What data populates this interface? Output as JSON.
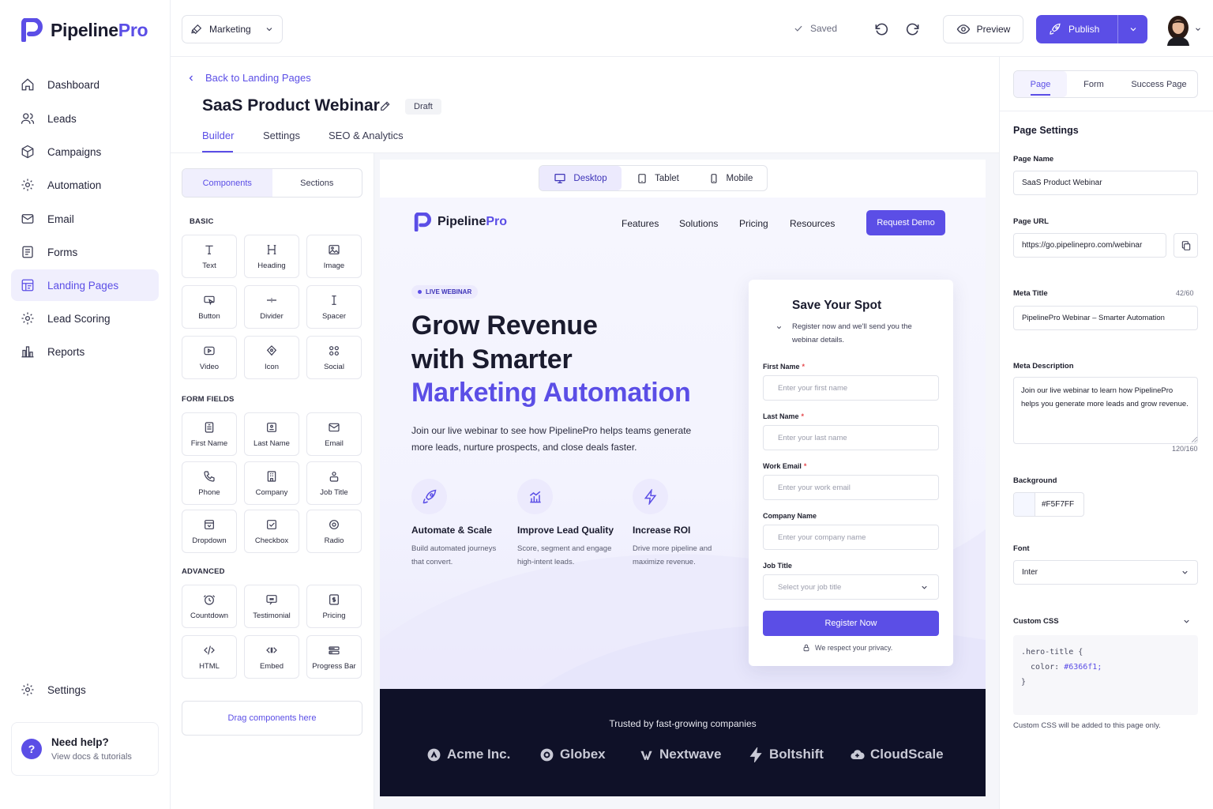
{
  "app": {
    "name_part1": "Pipeline",
    "name_part2": "Pro"
  },
  "nav": {
    "items": [
      {
        "label": "Dashboard",
        "icon": "home-icon"
      },
      {
        "label": "Leads",
        "icon": "users-icon"
      },
      {
        "label": "Campaigns",
        "icon": "box-icon"
      },
      {
        "label": "Automation",
        "icon": "gear-icon"
      },
      {
        "label": "Email",
        "icon": "mail-icon"
      },
      {
        "label": "Forms",
        "icon": "form-icon"
      },
      {
        "label": "Landing Pages",
        "icon": "layout-icon",
        "active": true
      },
      {
        "label": "Lead Scoring",
        "icon": "gear-icon"
      },
      {
        "label": "Reports",
        "icon": "chart-icon"
      }
    ],
    "settings": "Settings",
    "help_title": "Need help?",
    "help_sub": "View docs & tutorials"
  },
  "topbar": {
    "workspace": "Marketing",
    "saved": "Saved",
    "preview": "Preview",
    "publish": "Publish"
  },
  "page": {
    "back": "Back to Landing Pages",
    "title": "SaaS Product Webinar",
    "status": "Draft",
    "tabs": [
      "Builder",
      "Settings",
      "SEO & Analytics"
    ]
  },
  "components": {
    "tabs": [
      "Components",
      "Sections"
    ],
    "basic_title": "BASIC",
    "basic": [
      "Text",
      "Heading",
      "Image",
      "Button",
      "Divider",
      "Spacer",
      "Video",
      "Icon",
      "Social"
    ],
    "form_title": "FORM FIELDS",
    "form": [
      "First Name",
      "Last Name",
      "Email",
      "Phone",
      "Company",
      "Job Title",
      "Dropdown",
      "Checkbox",
      "Radio"
    ],
    "advanced_title": "ADVANCED",
    "advanced": [
      "Countdown",
      "Testimonial",
      "Pricing",
      "HTML",
      "Embed",
      "Progress Bar"
    ],
    "dropzone": "Drag components here"
  },
  "devices": [
    "Desktop",
    "Tablet",
    "Mobile"
  ],
  "landing": {
    "logo1": "Pipeline",
    "logo2": "Pro",
    "nav": [
      "Features",
      "Solutions",
      "Pricing",
      "Resources"
    ],
    "cta": "Request Demo",
    "badge": "LIVE WEBINAR",
    "hero1": "Grow Revenue",
    "hero2": "with Smarter",
    "hero3": "Marketing Automation",
    "sub": "Join our live webinar to see how PipelinePro helps teams generate more leads, nurture prospects, and close deals faster.",
    "features": [
      {
        "title": "Automate & Scale",
        "desc": "Build automated journeys that convert.",
        "icon": "rocket-icon"
      },
      {
        "title": "Improve Lead Quality",
        "desc": "Score, segment and engage high-intent leads.",
        "icon": "bar-chart-icon"
      },
      {
        "title": "Increase ROI",
        "desc": "Drive more pipeline and maximize revenue.",
        "icon": "bolt-icon"
      }
    ],
    "form": {
      "title": "Save Your Spot",
      "desc": "Register now and we'll send you the webinar details.",
      "fields": [
        {
          "label": "First Name",
          "required": true,
          "placeholder": "Enter your first name"
        },
        {
          "label": "Last Name",
          "required": true,
          "placeholder": "Enter your last name"
        },
        {
          "label": "Work Email",
          "required": true,
          "placeholder": "Enter your work email"
        },
        {
          "label": "Company Name",
          "required": false,
          "placeholder": "Enter your company name"
        },
        {
          "label": "Job Title",
          "required": false,
          "placeholder": "Select your job title"
        }
      ],
      "submit": "Register Now",
      "privacy": "We respect your privacy."
    },
    "trusted": "Trusted by fast-growing companies",
    "companies": [
      "Acme Inc.",
      "Globex",
      "Nextwave",
      "Boltshift",
      "CloudScale"
    ]
  },
  "settings": {
    "tabs": [
      "Page",
      "Form",
      "Success Page"
    ],
    "heading": "Page Settings",
    "page_name_label": "Page Name",
    "page_name": "SaaS Product Webinar",
    "page_url_label": "Page URL",
    "page_url": "https://go.pipelinepro.com/webinar",
    "meta_title_label": "Meta Title",
    "meta_title_count": "42/60",
    "meta_title": "PipelinePro Webinar – Smarter Automation",
    "meta_desc_label": "Meta Description",
    "meta_desc": "Join our live webinar to learn how PipelinePro helps you generate more leads and grow revenue.",
    "meta_desc_count": "120/160",
    "bg_label": "Background",
    "bg_value": "#F5F7FF",
    "font_label": "Font",
    "font_value": "Inter",
    "css_label": "Custom CSS",
    "css_line1": ".hero-title {",
    "css_prop": "  color: ",
    "css_val": "#6366f1;",
    "css_line3": "}",
    "css_note": "Custom CSS will be added to this page only."
  }
}
